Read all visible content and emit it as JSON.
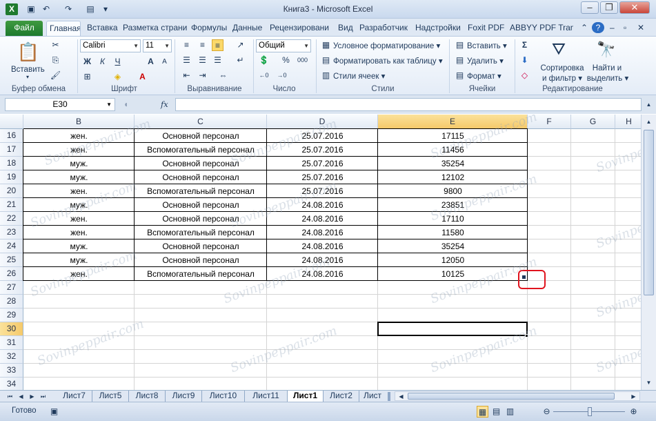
{
  "window": {
    "title": "Книга3 - Microsoft Excel",
    "minimize": "–",
    "restore": "❐",
    "close": "✕"
  },
  "ribbon_tabs": [
    "Файл",
    "Главная",
    "Вставка",
    "Разметка страни",
    "Формулы",
    "Данные",
    "Рецензировани",
    "Вид",
    "Разработчик",
    "Надстройки",
    "Foxit PDF",
    "ABBYY PDF Transf"
  ],
  "ribbon": {
    "clipboard": {
      "paste": "Вставить",
      "label": "Буфер обмена"
    },
    "font": {
      "name": "Calibri",
      "size": "11",
      "bold": "Ж",
      "italic": "К",
      "underline": "Ч",
      "label": "Шрифт"
    },
    "alignment": {
      "label": "Выравнивание"
    },
    "number": {
      "format": "Общий",
      "percent": "%",
      "thousands": "000",
      "label": "Число"
    },
    "styles": {
      "conditional": "Условное форматирование",
      "as_table": "Форматировать как таблицу",
      "cell_styles": "Стили ячеек",
      "label": "Стили"
    },
    "cells": {
      "insert": "Вставить",
      "delete": "Удалить",
      "format": "Формат",
      "label": "Ячейки"
    },
    "editing": {
      "sum": "Σ",
      "sort_line1": "Сортировка",
      "sort_line2": "и фильтр",
      "find_line1": "Найти и",
      "find_line2": "выделить",
      "label": "Редактирование"
    }
  },
  "formula_bar": {
    "name_box": "E30",
    "fx": "fx",
    "value": ""
  },
  "columns": [
    "B",
    "C",
    "D",
    "E",
    "F",
    "G",
    "H"
  ],
  "rows": [
    {
      "n": "16",
      "b": "жен.",
      "c": "Основной персонал",
      "d": "25.07.2016",
      "e": "17115"
    },
    {
      "n": "17",
      "b": "жен.",
      "c": "Вспомогательный персонал",
      "d": "25.07.2016",
      "e": "11456"
    },
    {
      "n": "18",
      "b": "муж.",
      "c": "Основной персонал",
      "d": "25.07.2016",
      "e": "35254"
    },
    {
      "n": "19",
      "b": "муж.",
      "c": "Основной персонал",
      "d": "25.07.2016",
      "e": "12102"
    },
    {
      "n": "20",
      "b": "жен.",
      "c": "Вспомогательный персонал",
      "d": "25.07.2016",
      "e": "9800"
    },
    {
      "n": "21",
      "b": "муж.",
      "c": "Основной персонал",
      "d": "24.08.2016",
      "e": "23851"
    },
    {
      "n": "22",
      "b": "жен.",
      "c": "Основной персонал",
      "d": "24.08.2016",
      "e": "17110"
    },
    {
      "n": "23",
      "b": "жен.",
      "c": "Вспомогательный персонал",
      "d": "24.08.2016",
      "e": "11580"
    },
    {
      "n": "24",
      "b": "муж.",
      "c": "Основной персонал",
      "d": "24.08.2016",
      "e": "35254"
    },
    {
      "n": "25",
      "b": "муж.",
      "c": "Основной персонал",
      "d": "24.08.2016",
      "e": "12050"
    },
    {
      "n": "26",
      "b": "жен.",
      "c": "Вспомогательный персонал",
      "d": "24.08.2016",
      "e": "10125"
    }
  ],
  "empty_rows": [
    "27",
    "28",
    "29",
    "30",
    "31",
    "32",
    "33",
    "34"
  ],
  "selected_cell": "E30",
  "sheet_tabs": [
    "Лист7",
    "Лист5",
    "Лист8",
    "Лист9",
    "Лист10",
    "Лист11",
    "Лист1",
    "Лист2",
    "Лист"
  ],
  "active_sheet": "Лист1",
  "status": {
    "ready": "Готово"
  },
  "watermark": "Sovinpeppair.com",
  "colors": {
    "file_tab": "#1e7a2e",
    "selection_header": "#f5c96a",
    "highlight_circle": "#e0141e"
  }
}
